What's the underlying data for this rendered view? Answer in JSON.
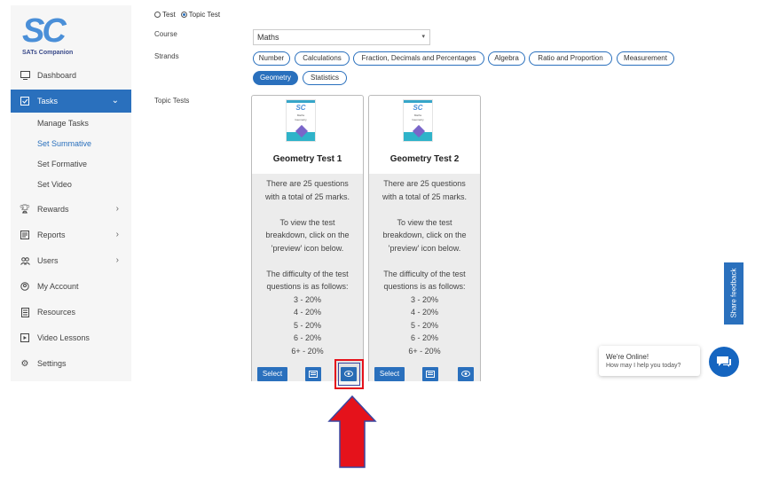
{
  "brand": {
    "logo_letters": "SC",
    "name": "SATs Companion"
  },
  "sidebar": {
    "items": [
      {
        "label": "Dashboard",
        "icon": "monitor-icon"
      },
      {
        "label": "Tasks",
        "icon": "tasks-icon",
        "active": true
      },
      {
        "label": "Rewards",
        "icon": "trophy-icon"
      },
      {
        "label": "Reports",
        "icon": "reports-icon"
      },
      {
        "label": "Users",
        "icon": "users-icon"
      },
      {
        "label": "My Account",
        "icon": "account-icon"
      },
      {
        "label": "Resources",
        "icon": "resources-icon"
      },
      {
        "label": "Video Lessons",
        "icon": "video-icon"
      },
      {
        "label": "Settings",
        "icon": "gear-icon"
      }
    ],
    "tasks_sub": [
      "Manage Tasks",
      "Set Summative",
      "Set Formative",
      "Set Video"
    ],
    "current_sub": "Set Summative"
  },
  "form": {
    "test_type": {
      "options": [
        "Test",
        "Topic Test"
      ],
      "selected": "Topic Test"
    },
    "course": {
      "label": "Course",
      "value": "Maths"
    },
    "strands": {
      "label": "Strands",
      "options": [
        "Number",
        "Calculations",
        "Fraction, Decimals and Percentages",
        "Algebra",
        "Ratio and Proportion",
        "Measurement",
        "Geometry",
        "Statistics"
      ],
      "selected": "Geometry"
    },
    "topic_tests_label": "Topic Tests"
  },
  "cards": [
    {
      "thumb_lines": [
        "Maths",
        "Geometry"
      ],
      "title": "Geometry Test 1",
      "description": "There are 25 questions\nwith a total of 25 marks.\n\nTo view the test\nbreakdown, click on the\n'preview' icon below.\n\nThe difficulty of the test\nquestions is as follows:\n3 - 20%\n4 - 20%\n5 - 20%\n6 - 20%\n6+ - 20%",
      "select_label": "Select"
    },
    {
      "thumb_lines": [
        "Maths",
        "Geometry"
      ],
      "title": "Geometry Test 2",
      "description": "There are 25 questions\nwith a total of 25 marks.\n\nTo view the test\nbreakdown, click on the\n'preview' icon below.\n\nThe difficulty of the test\nquestions is as follows:\n3 - 20%\n4 - 20%\n5 - 20%\n6 - 20%\n6+ - 20%",
      "select_label": "Select"
    }
  ],
  "feedback_tab": "Share feedback",
  "chat": {
    "title": "We're Online!",
    "subtitle": "How may I help you today?"
  },
  "colors": {
    "primary": "#2a70bd",
    "annotation": "#e5121b",
    "chat": "#1565c0"
  }
}
